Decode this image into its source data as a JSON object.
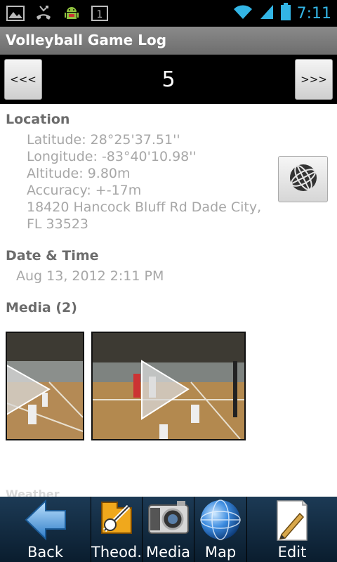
{
  "status_bar": {
    "time": "7:11",
    "notification_icons": [
      "image-icon",
      "missed-call-icon",
      "android-debug-icon",
      "sim-1-icon"
    ],
    "system_icons": [
      "wifi-icon",
      "signal-icon",
      "battery-icon"
    ],
    "accent_color": "#33b5e5"
  },
  "app": {
    "title": "Volleyball Game Log"
  },
  "nav": {
    "prev_label": "<<<",
    "next_label": ">>>",
    "game_number": "5"
  },
  "location": {
    "heading": "Location",
    "latitude": "Latitude: 28°25'37.51''",
    "longitude": "Longitude: -83°40'10.98''",
    "altitude": "Altitude: 9.80m",
    "accuracy": "Accuracy: +-17m",
    "address_line1": "18420 Hancock Bluff Rd Dade City,",
    "address_line2": "FL 33523",
    "map_button_icon": "globe-icon"
  },
  "datetime": {
    "heading": "Date & Time",
    "value": "Aug 13, 2012 2:11 PM"
  },
  "media": {
    "heading": "Media (2)",
    "thumbnails": [
      {
        "name": "video-thumbnail-1",
        "icon": "play-icon"
      },
      {
        "name": "video-thumbnail-2",
        "icon": "play-icon"
      }
    ]
  },
  "faded_heading": "Weather",
  "toolbar": {
    "items": [
      {
        "label": "Back",
        "icon": "back-arrow-icon"
      },
      {
        "label": "Theod.",
        "icon": "theodolite-icon"
      },
      {
        "label": "Media",
        "icon": "camera-icon"
      },
      {
        "label": "Map",
        "icon": "globe-icon"
      },
      {
        "label": "Edit",
        "icon": "pencil-note-icon"
      }
    ]
  }
}
